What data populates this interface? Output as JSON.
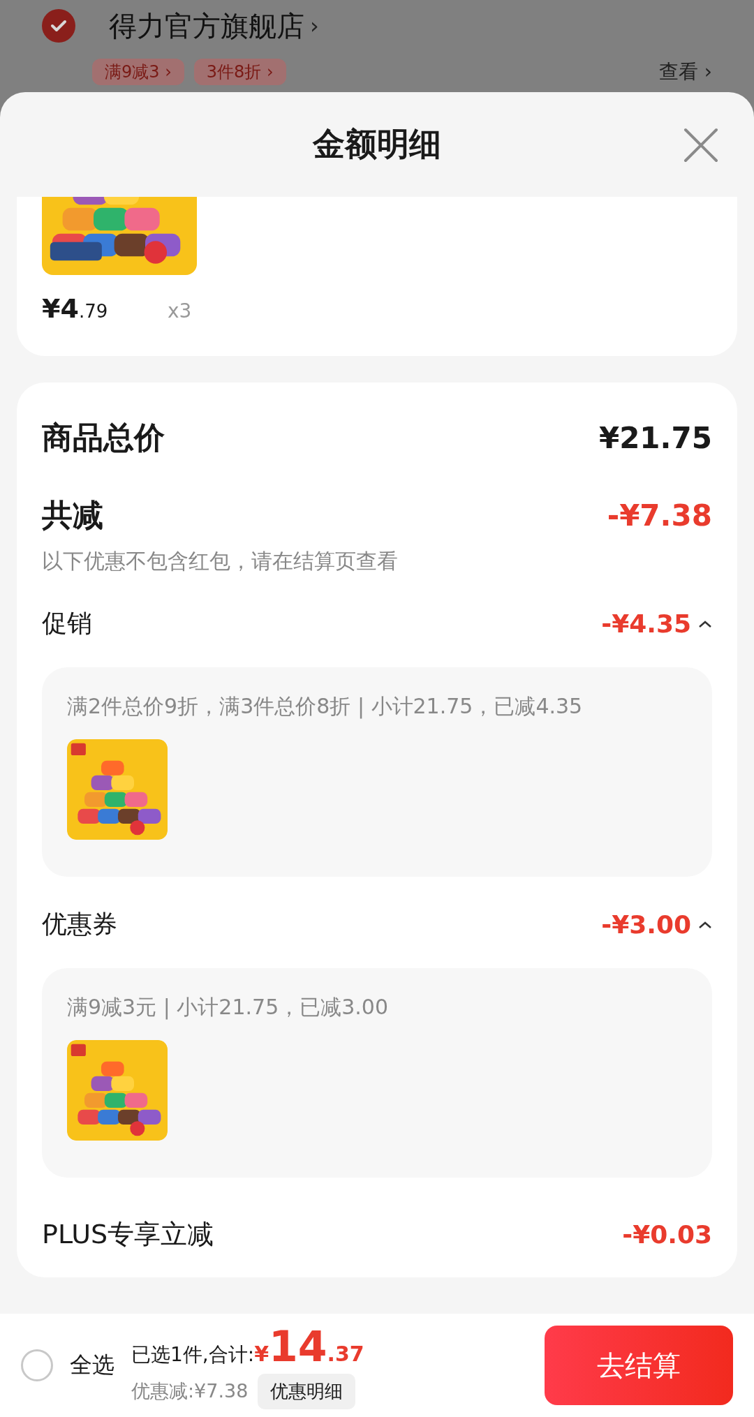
{
  "background_store": {
    "selected": true,
    "name": "得力官方旗舰店",
    "name_arrow": "›",
    "tags": [
      {
        "label": "满9减3 ›"
      },
      {
        "label": "3件8折 ›"
      }
    ],
    "view_link": "查看 ›"
  },
  "sheet": {
    "title": "金额明细",
    "items": [
      {
        "price_main": "¥4",
        "price_decimal": ".79",
        "quantity": "x3"
      }
    ]
  },
  "summary": {
    "total_label": "商品总价",
    "total_value": "¥21.75",
    "discount_label": "共减",
    "discount_value": "-¥7.38",
    "discount_note": "以下优惠不包含红包，请在结算页查看",
    "groups": [
      {
        "label": "促销",
        "amount": "-¥4.35",
        "expanded": true,
        "detail": "满2件总价9折，满3件总价8折 | 小计21.75，已减4.35"
      },
      {
        "label": "优惠券",
        "amount": "-¥3.00",
        "expanded": true,
        "detail": "满9减3元 | 小计21.75，已减3.00"
      }
    ],
    "plus": {
      "label": "PLUS专享立减",
      "amount": "-¥0.03"
    }
  },
  "footer": {
    "select_all": {
      "label": "全选",
      "checked": false
    },
    "selected_text": "已选1件,合计:",
    "total_symbol": "¥",
    "total_main": "14",
    "total_decimal": ".37",
    "discount_text": "优惠减:¥7.38",
    "detail_button": "优惠明细",
    "checkout_button": "去结算"
  }
}
